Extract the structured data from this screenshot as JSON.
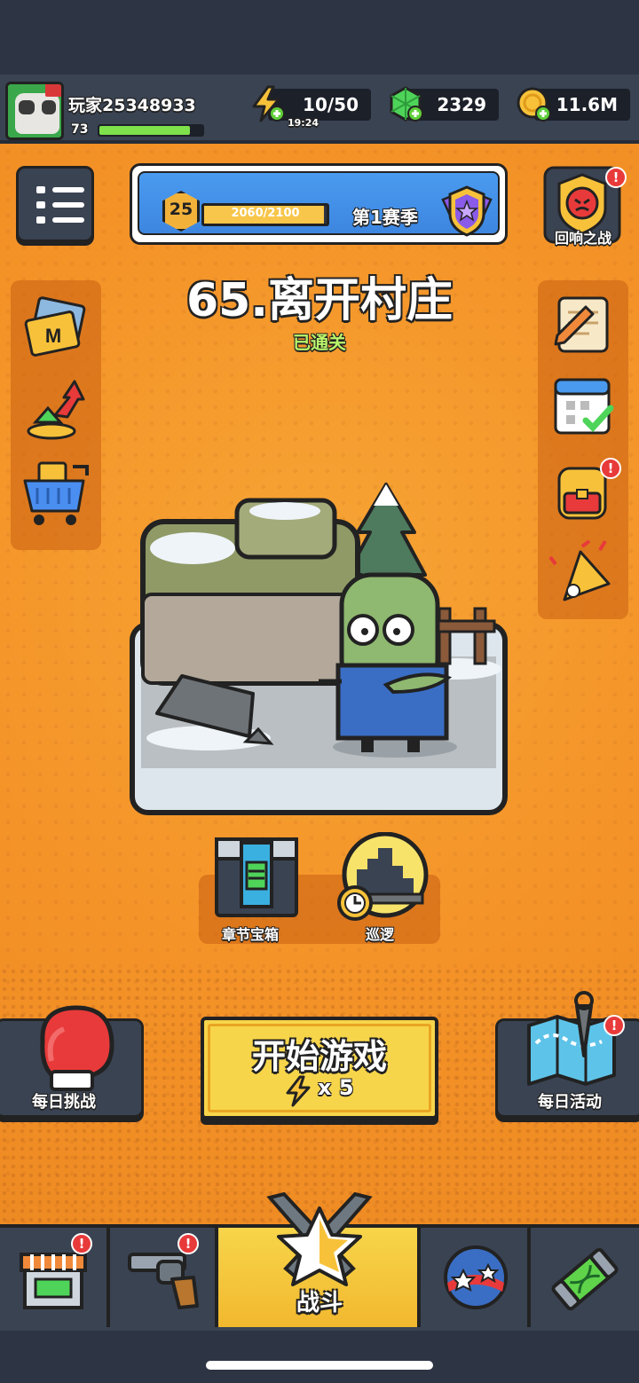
{
  "player": {
    "name": "玩家25348933",
    "level": "73",
    "xp_progress": 0.88
  },
  "resources": {
    "energy": "10/50",
    "energy_timer": "19:24",
    "gems": "2329",
    "coins": "11.6M"
  },
  "season": {
    "level": "25",
    "xp": "2060/2100",
    "progress": 0.98,
    "label": "第1赛季"
  },
  "top_right": {
    "label": "回响之战",
    "badge": "!"
  },
  "stage": {
    "title": "65.离开村庄",
    "status": "已通关"
  },
  "mini_actions": {
    "chest_label": "章节宝箱",
    "patrol_label": "巡逻"
  },
  "actions": {
    "daily_challenge": "每日挑战",
    "start_label": "开始游戏",
    "start_cost": "x 5",
    "daily_event": "每日活动",
    "badge": "!"
  },
  "nav": {
    "battle_label": "战斗",
    "badge": "!"
  },
  "icons": {
    "energy": "lightning-icon",
    "gem": "gem-icon",
    "coin": "coin-icon",
    "menu": "menu-list-icon",
    "season_badge": "star-shield-icon",
    "shop": "shop-icon",
    "weapon": "revolver-icon",
    "battle": "star-crossed-swords-icon",
    "orb": "star-orb-icon",
    "gene": "dna-capsule-icon"
  },
  "colors": {
    "background": "#f59a2a",
    "panel": "#3a4352",
    "accent_yellow": "#f7d54a",
    "xp_green": "#7ee04a",
    "status_green": "#b9f56a",
    "badge_red": "#e83a3a"
  }
}
